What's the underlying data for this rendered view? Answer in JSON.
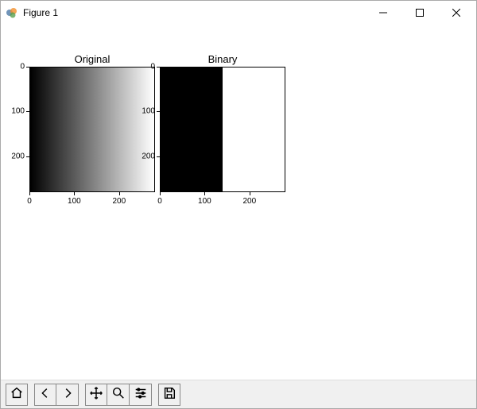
{
  "window": {
    "title": "Figure 1"
  },
  "chart_data": [
    {
      "type": "heatmap",
      "title": "Original",
      "xlabel": "",
      "ylabel": "",
      "xlim": [
        0,
        280
      ],
      "ylim": [
        280,
        0
      ],
      "xticks": [
        0,
        100,
        200
      ],
      "yticks": [
        0,
        100,
        200
      ],
      "description": "grayscale horizontal gradient, black at x=0 to white at x≈280"
    },
    {
      "type": "heatmap",
      "title": "Binary",
      "xlabel": "",
      "ylabel": "",
      "xlim": [
        0,
        280
      ],
      "ylim": [
        280,
        0
      ],
      "xticks": [
        0,
        100,
        200
      ],
      "yticks": [
        0,
        100,
        200
      ],
      "description": "thresholded image: black for x<≈140, white for x≥≈140",
      "threshold_x": 140
    }
  ],
  "ticks": {
    "y": {
      "t0": "0",
      "t1": "100",
      "t2": "200"
    },
    "x": {
      "t0": "0",
      "t1": "100",
      "t2": "200"
    }
  },
  "toolbar": {
    "home": "Home",
    "back": "Back",
    "forward": "Forward",
    "pan": "Pan",
    "zoom": "Zoom",
    "configure": "Configure subplots",
    "save": "Save"
  }
}
